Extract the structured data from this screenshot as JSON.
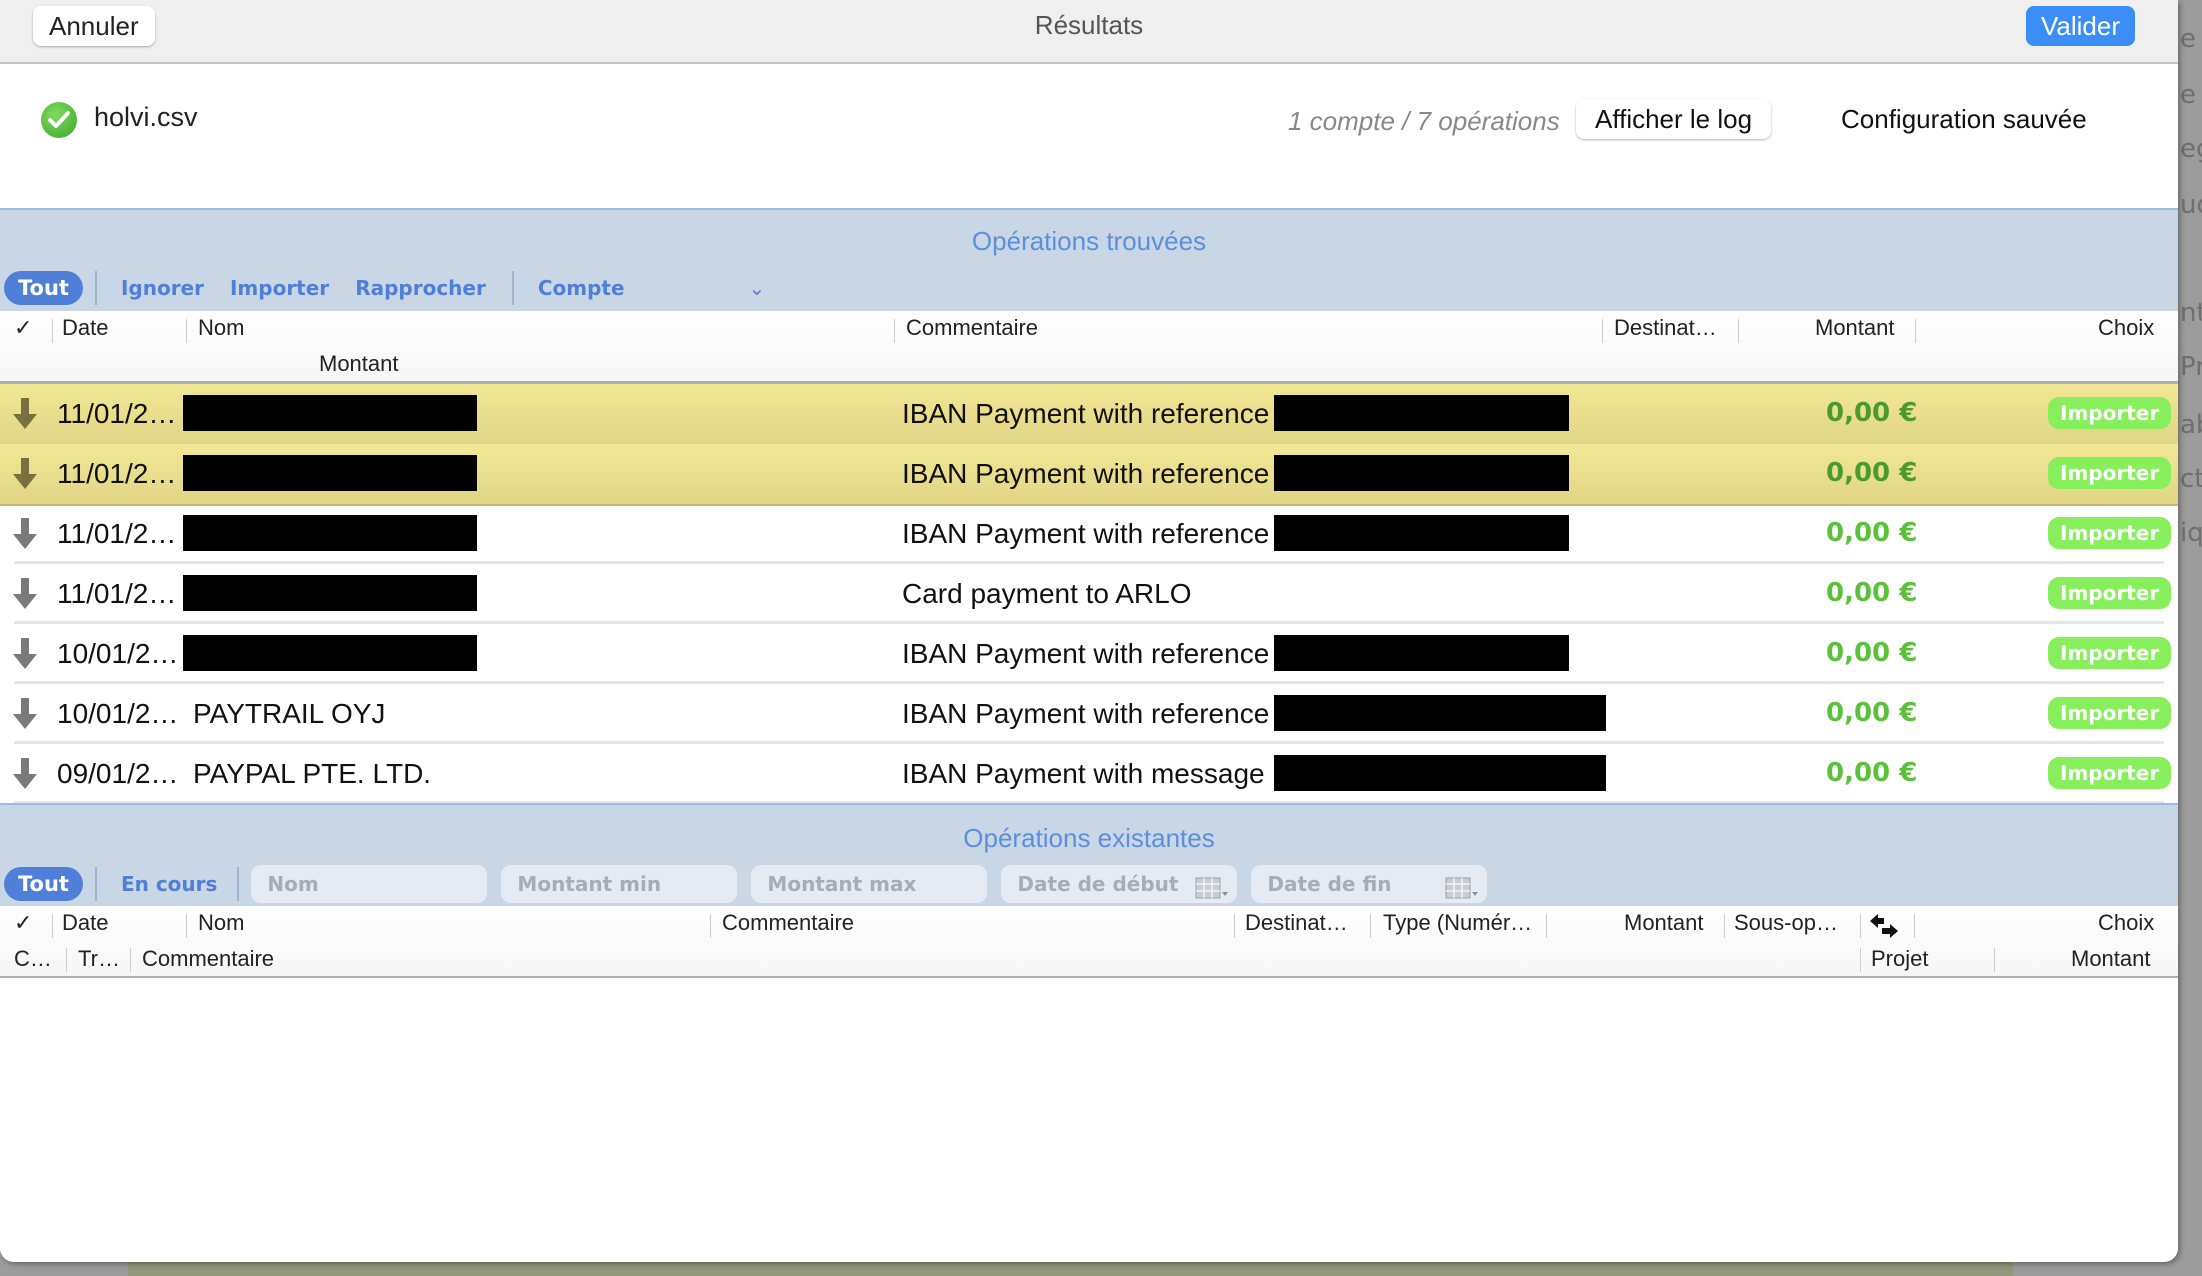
{
  "window": {
    "title": "Résultats",
    "cancel_label": "Annuler",
    "validate_label": "Valider"
  },
  "file": {
    "name": "holvi.csv",
    "status": "ok",
    "summary": "1 compte / 7 opérations",
    "show_log_label": "Afficher le log",
    "config_status": "Configuration sauvée"
  },
  "found": {
    "title": "Opérations trouvées",
    "filters": {
      "all_label": "Tout",
      "ignore_label": "Ignorer",
      "import_label": "Importer",
      "reconcile_label": "Rapprocher",
      "account_label": "Compte"
    },
    "columns": {
      "check": "✓",
      "date": "Date",
      "name": "Nom",
      "comment": "Commentaire",
      "recipient": "Destinat…",
      "amount": "Montant",
      "choice": "Choix",
      "amount2": "Montant"
    },
    "rows": [
      {
        "date": "11/01/2…",
        "name": "",
        "name_redacted": true,
        "comment": "IBAN Payment with reference",
        "comment_redacted": true,
        "amount": "0,00 €",
        "choice": "Importer",
        "highlighted": true
      },
      {
        "date": "11/01/2…",
        "name": "",
        "name_redacted": true,
        "comment": "IBAN Payment with reference",
        "comment_redacted": true,
        "amount": "0,00 €",
        "choice": "Importer",
        "highlighted": true
      },
      {
        "date": "11/01/2…",
        "name": "",
        "name_redacted": true,
        "comment": "IBAN Payment with reference",
        "comment_redacted": true,
        "amount": "0,00 €",
        "choice": "Importer",
        "highlighted": false
      },
      {
        "date": "11/01/2…",
        "name": "",
        "name_redacted": true,
        "comment": "Card payment to ARLO",
        "comment_redacted": false,
        "amount": "0,00 €",
        "choice": "Importer",
        "highlighted": false
      },
      {
        "date": "10/01/2…",
        "name": "",
        "name_redacted": true,
        "comment": "IBAN Payment with reference",
        "comment_redacted": true,
        "amount": "0,00 €",
        "choice": "Importer",
        "highlighted": false
      },
      {
        "date": "10/01/2…",
        "name": "PAYTRAIL OYJ",
        "name_redacted": false,
        "comment": "IBAN Payment with reference",
        "comment_redacted": true,
        "amount": "0,00 €",
        "choice": "Importer",
        "highlighted": false
      },
      {
        "date": "09/01/2…",
        "name": "PAYPAL PTE. LTD.",
        "name_redacted": false,
        "comment": "IBAN Payment with message",
        "comment_redacted": true,
        "amount": "0,00 €",
        "choice": "Importer",
        "highlighted": false
      }
    ]
  },
  "existing": {
    "title": "Opérations existantes",
    "filters": {
      "all_label": "Tout",
      "pending_label": "En cours",
      "name_placeholder": "Nom",
      "min_placeholder": "Montant min",
      "max_placeholder": "Montant max",
      "start_placeholder": "Date de début",
      "end_placeholder": "Date de fin"
    },
    "columns": {
      "check": "✓",
      "date": "Date",
      "name": "Nom",
      "comment": "Commentaire",
      "recipient": "Destinat…",
      "type": "Type (Numér…",
      "amount": "Montant",
      "subop": "Sous-op…",
      "choice": "Choix",
      "c": "C…",
      "tr": "Tr…",
      "comment2": "Commentaire",
      "project": "Projet",
      "amount2": "Montant"
    }
  },
  "background_fragments": [
    "e T",
    "e T",
    "ego",
    "ud",
    "nta",
    "Pro",
    "ab",
    "ct",
    "iqu"
  ]
}
